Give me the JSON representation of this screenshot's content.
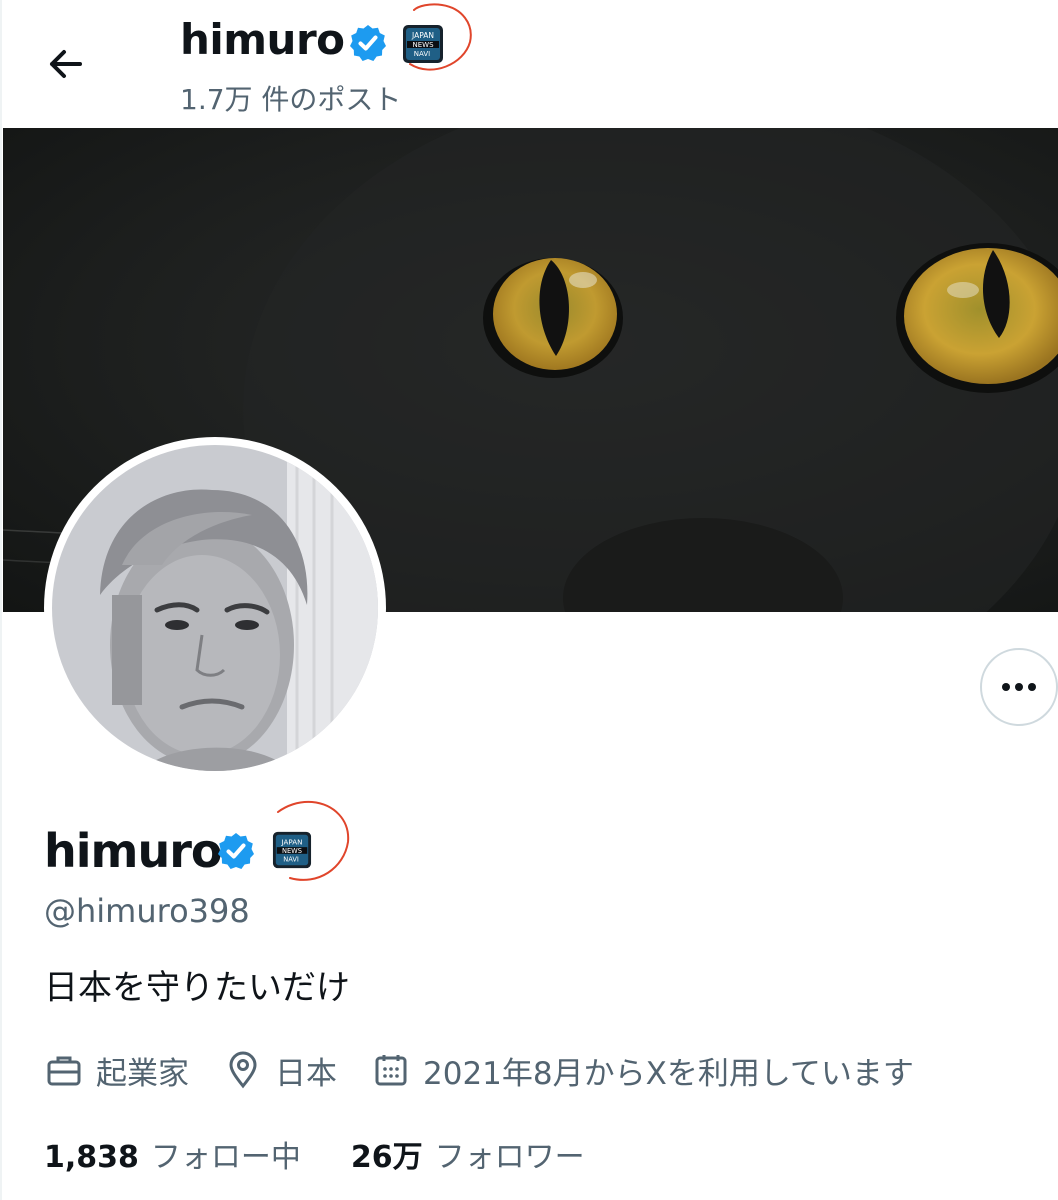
{
  "header": {
    "display_name": "himuro",
    "post_count": "1.7万 件のポスト"
  },
  "profile": {
    "display_name": "himuro",
    "handle": "@himuro398",
    "bio": "日本を守りたいだけ",
    "occupation": "起業家",
    "location": "日本",
    "joined": "2021年8月からXを利用しています",
    "following_count": "1,838",
    "following_label": "フォロー中",
    "followers_count": "26万",
    "followers_label": "フォロワー"
  },
  "affiliate_badge": {
    "line1": "JAPAN",
    "line2": "NEWS",
    "line3": "NAVI"
  },
  "colors": {
    "accent": "#1d9bf0",
    "secondary_text": "#536471",
    "annotation": "#e0452b"
  },
  "icons": [
    "back-arrow-icon",
    "verified-icon",
    "affiliate-badge-icon",
    "more-icon",
    "briefcase-icon",
    "location-pin-icon",
    "calendar-icon"
  ]
}
